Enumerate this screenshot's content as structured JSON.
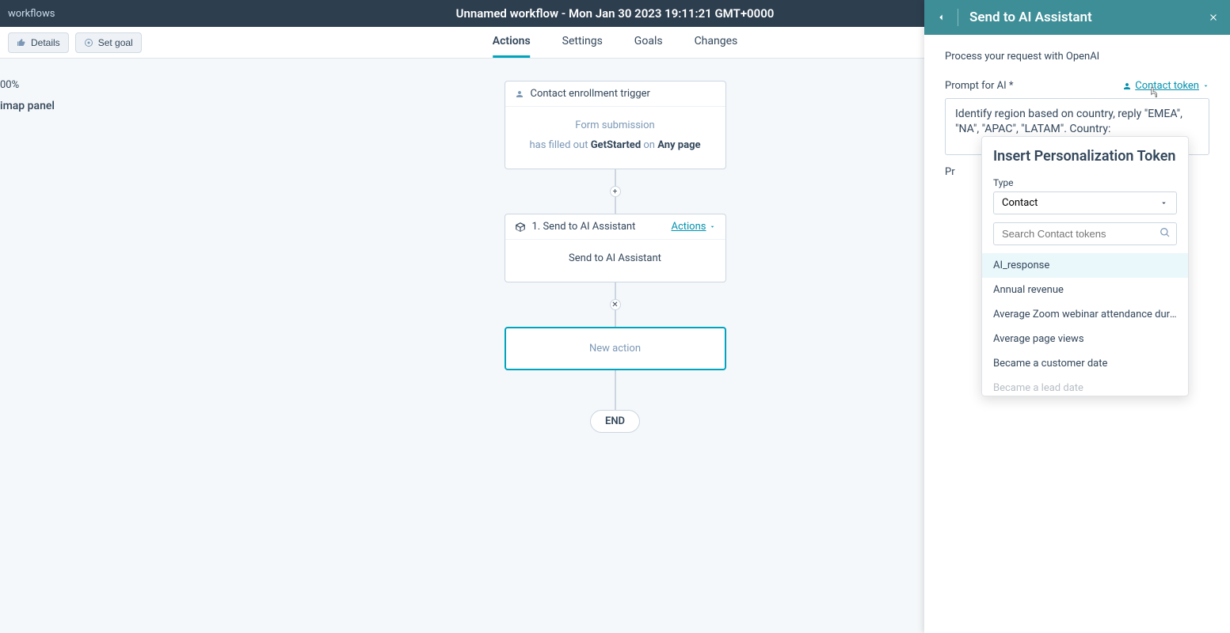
{
  "topbar": {
    "workflows_link": "workflows",
    "title": "Unnamed workflow - Mon Jan 30 2023 19:11:21 GMT+0000"
  },
  "secondary": {
    "details_btn": "Details",
    "setgoal_btn": "Set goal",
    "tabs": {
      "actions": "Actions",
      "settings": "Settings",
      "goals": "Goals",
      "changes": "Changes"
    }
  },
  "canvas": {
    "zoom": "00%",
    "minimap": "imap panel",
    "trigger": {
      "title": "Contact enrollment trigger",
      "form_line": "Form submission",
      "desc_prefix": "has filled out ",
      "desc_bold": "GetStarted",
      "desc_mid": " on ",
      "desc_bold2": "Any page"
    },
    "action1": {
      "index": "1. Send to AI Assistant",
      "actions_label": "Actions",
      "body": "Send to AI Assistant"
    },
    "new_action": "New action",
    "end": "END"
  },
  "panel": {
    "title": "Send to AI Assistant",
    "process_line": "Process your request with OpenAI",
    "prompt_label": "Prompt for AI *",
    "token_link": "Contact token",
    "prompt_text": "Identify region based on country, reply \"EMEA\", \"NA\", \"APAC\", \"LATAM\". Country:",
    "prop_label_partial": "Pr"
  },
  "popover": {
    "title": "Insert Personalization Token",
    "type_label": "Type",
    "type_value": "Contact",
    "search_placeholder": "Search Contact tokens",
    "tokens": [
      "AI_response",
      "Annual revenue",
      "Average Zoom webinar attendance durat…",
      "Average page views",
      "Became a customer date",
      "Became a lead date"
    ]
  }
}
